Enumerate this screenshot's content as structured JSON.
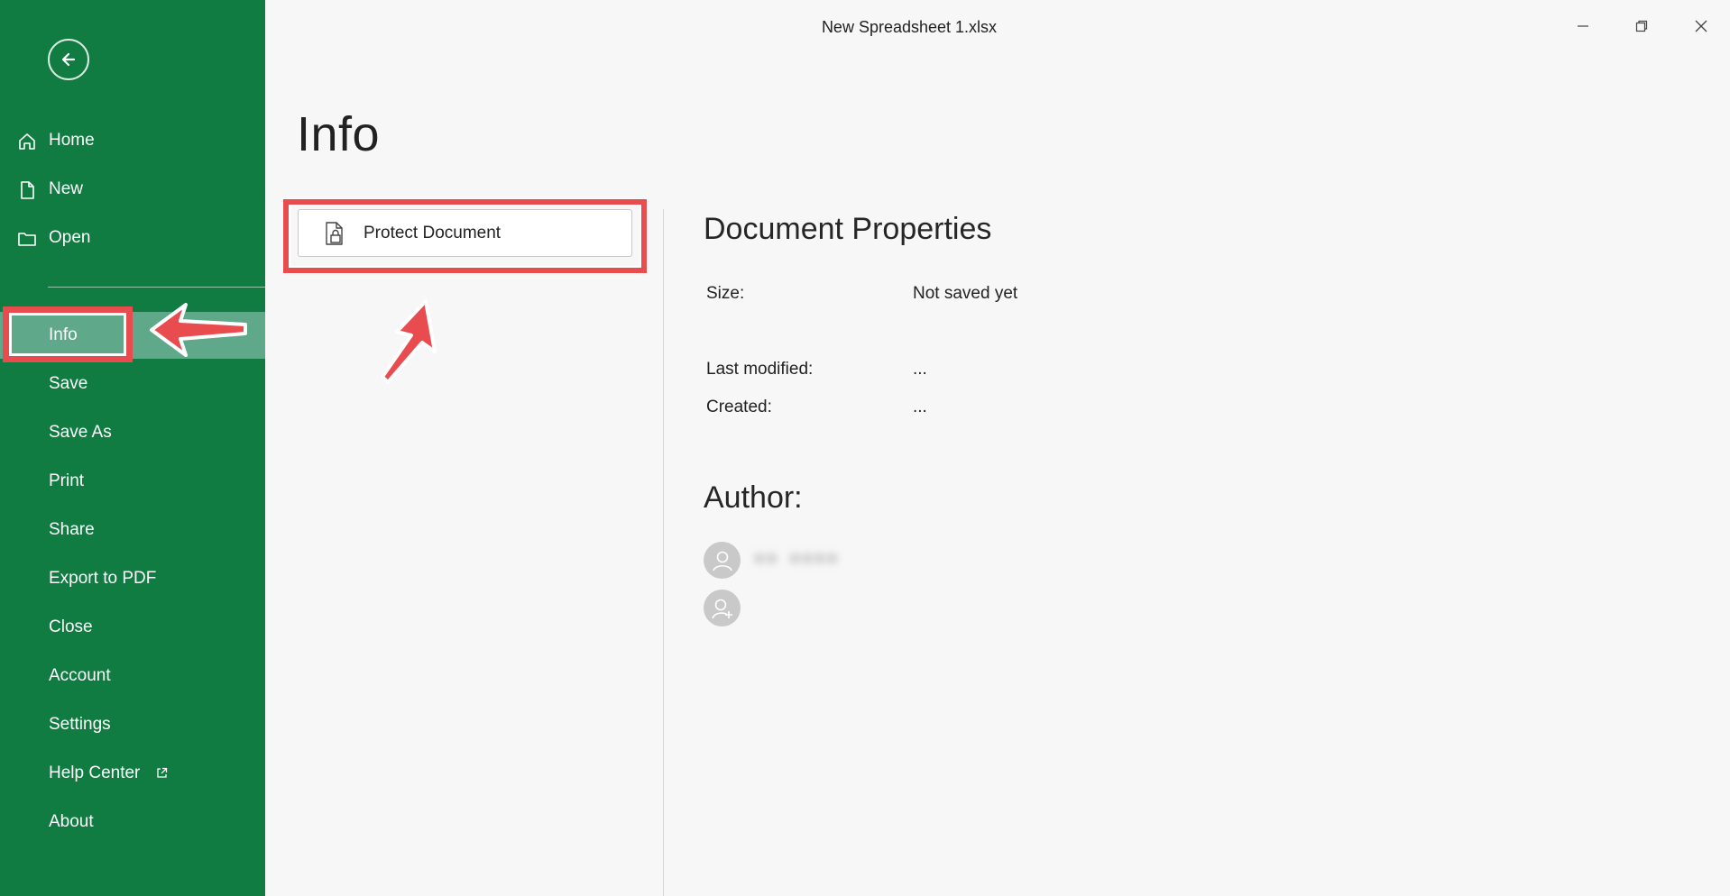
{
  "window": {
    "title": "New Spreadsheet 1.xlsx",
    "controls": [
      "minimize-icon",
      "restore-icon",
      "close-icon"
    ]
  },
  "sidebar": {
    "background": "#107c41",
    "active_background": "#5fa889",
    "back_icon": "arrow-left-icon",
    "items": [
      {
        "label": "Home",
        "icon": "home-icon"
      },
      {
        "label": "New",
        "icon": "new-file-icon"
      },
      {
        "label": "Open",
        "icon": "folder-icon"
      },
      {
        "label": "Info",
        "active": true
      },
      {
        "label": "Save"
      },
      {
        "label": "Save As"
      },
      {
        "label": "Print"
      },
      {
        "label": "Share"
      },
      {
        "label": "Export to PDF"
      },
      {
        "label": "Close"
      },
      {
        "label": "Account"
      },
      {
        "label": "Settings"
      },
      {
        "label": "Help Center",
        "icon": "external-link-icon"
      },
      {
        "label": "About"
      }
    ]
  },
  "main": {
    "title": "Info",
    "protect_button": {
      "label": "Protect Document",
      "icon": "lock-document-icon"
    },
    "document_properties": {
      "heading": "Document Properties",
      "rows": [
        {
          "label": "Size:",
          "value": "Not saved yet"
        },
        {
          "label": "Last modified:",
          "value": "..."
        },
        {
          "label": "Created:",
          "value": "..."
        }
      ]
    },
    "author": {
      "heading": "Author:",
      "name": "•• ••••",
      "add_icon": "add-person-icon"
    }
  },
  "annotations": {
    "highlight_color": "#e84c4f"
  }
}
